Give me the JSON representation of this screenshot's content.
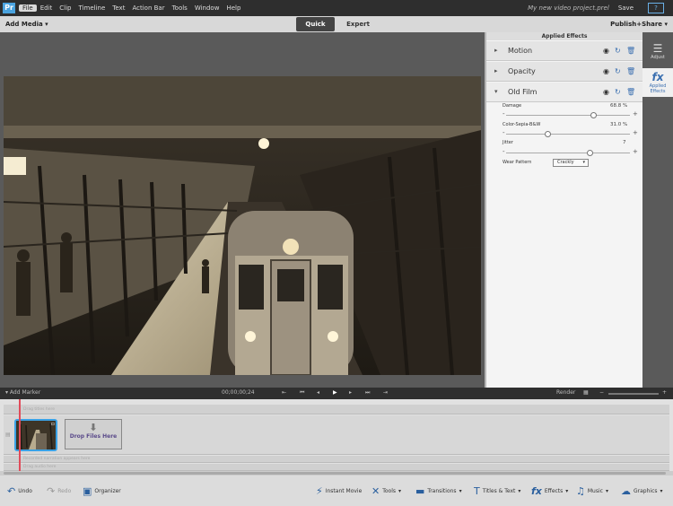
{
  "menu": {
    "items": [
      "File",
      "Edit",
      "Clip",
      "Timeline",
      "Text",
      "Action Bar",
      "Tools",
      "Window",
      "Help"
    ],
    "project_name": "My new video project.prel",
    "save_label": "Save"
  },
  "modebar": {
    "add_media": "Add Media ▾",
    "tabs": [
      "Quick",
      "Expert"
    ],
    "publish": "Publish+Share ▾"
  },
  "effects_panel": {
    "title": "Applied Effects",
    "effects": [
      {
        "name": "Motion",
        "expanded": false
      },
      {
        "name": "Opacity",
        "expanded": false
      },
      {
        "name": "Old Film",
        "expanded": true
      }
    ],
    "params": [
      {
        "label": "Damage",
        "value": "68.8 %",
        "level": 0.68
      },
      {
        "label": "Color-Sepia-B&W",
        "value": "31.0 %",
        "level": 0.31
      },
      {
        "label": "Jitter",
        "value": "7",
        "level": 0.65
      }
    ],
    "preset_label": "Wear Pattern",
    "preset_value": "Crackly"
  },
  "sidetools": [
    {
      "label": "Adjust",
      "icon": "sliders-icon"
    },
    {
      "label": "Applied Effects",
      "icon": "fx-icon"
    }
  ],
  "transport": {
    "add_marker": "Add Marker",
    "timecode": "00;00;00;24",
    "render": "Render"
  },
  "timeline": {
    "track_title": "Drag titles here",
    "drop_files": "Drop Files Here",
    "narration": "Recorded narration appears here",
    "audio": "Drag audio here"
  },
  "bottombar": {
    "undo": "Undo",
    "redo": "Redo",
    "organizer": "Organizer",
    "instant_movie": "Instant Movie",
    "tools": "Tools",
    "transitions": "Transitions",
    "titles": "Titles & Text",
    "effects": "Effects",
    "music": "Music",
    "graphics": "Graphics"
  },
  "colors": {
    "accent": "#3aa2e6",
    "playhead": "#e14b5a"
  }
}
